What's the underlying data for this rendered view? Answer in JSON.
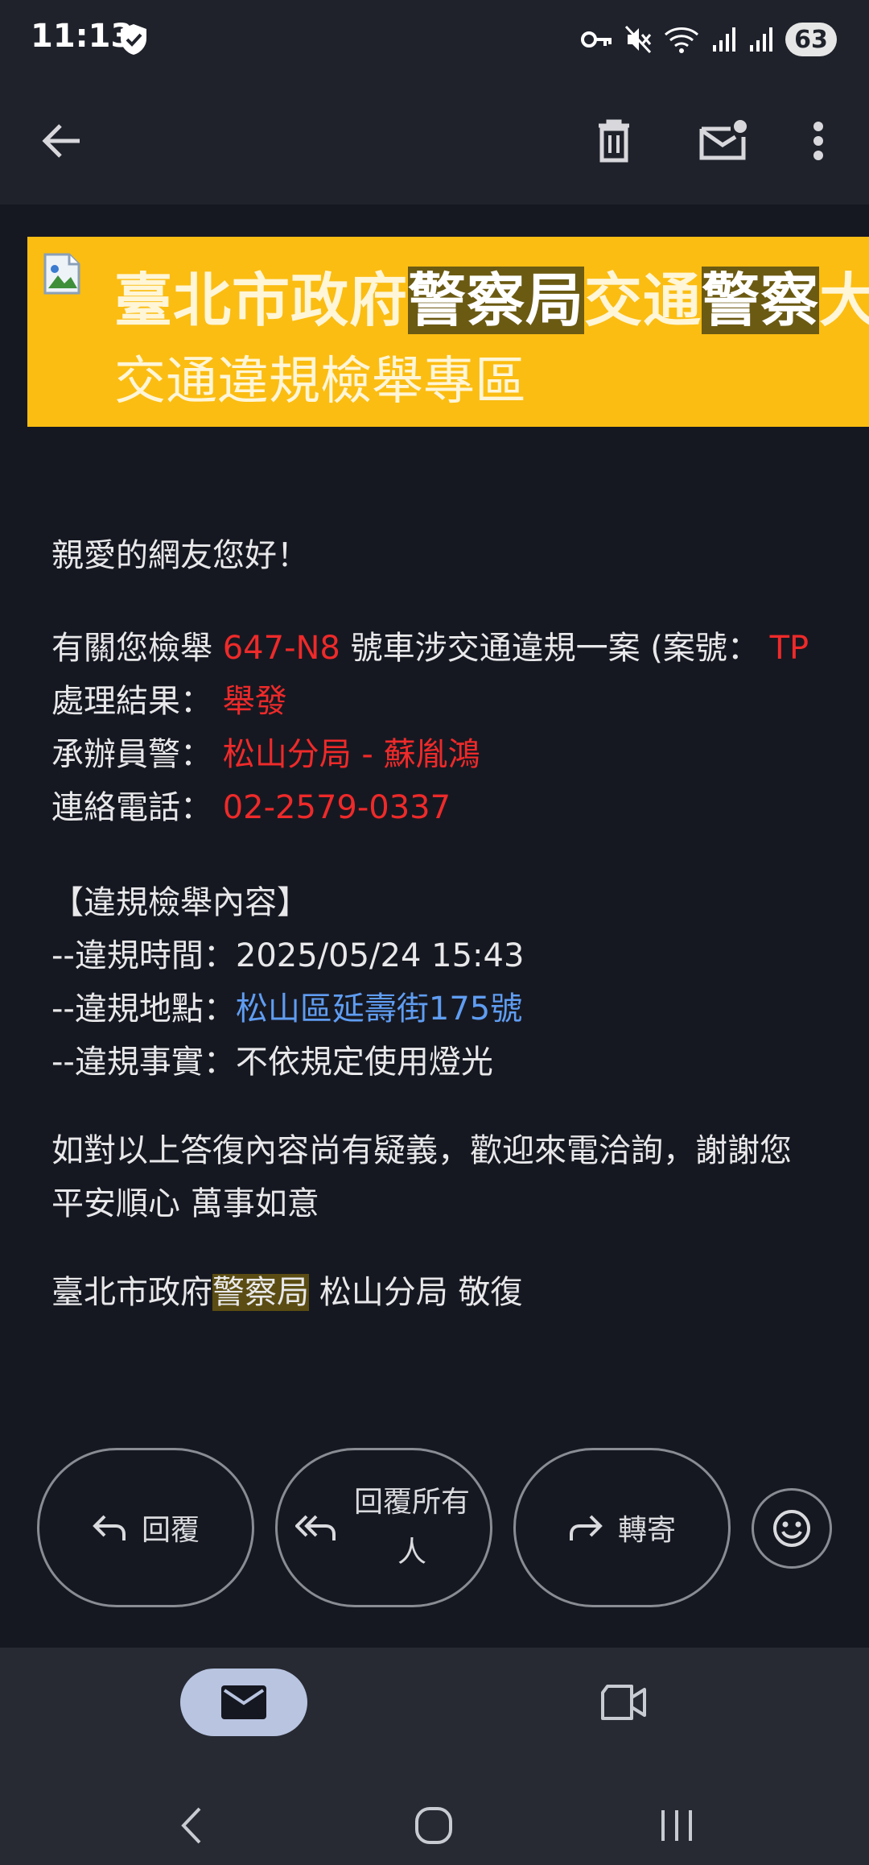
{
  "status_bar": {
    "time": "11:13",
    "battery": "63"
  },
  "app_bar": {
    "icons": [
      "arrow-back-icon",
      "trash-icon",
      "mark-unread-icon",
      "more-vert-icon"
    ]
  },
  "email": {
    "banner": {
      "line1_parts": [
        "臺北市政府",
        "警察局",
        "交通",
        "警察",
        "大"
      ],
      "line2": "交通違規檢舉專區"
    },
    "greeting": "親愛的網友您好！",
    "report_line": {
      "prefix": "有關您檢舉 ",
      "plate": "647-N8",
      "middle": " 號車涉交通違規一案 (案號： ",
      "case_no": "TP"
    },
    "result": {
      "label": "處理結果： ",
      "value": "舉發"
    },
    "officer": {
      "label": "承辦員警： ",
      "value": "松山分局 - 蘇胤鴻"
    },
    "phone": {
      "label": "連絡電話： ",
      "value": "02-2579-0337"
    },
    "section_title": "【違規檢舉內容】",
    "violation_time": "--違規時間：2025/05/24 15:43",
    "violation_place": {
      "label": "--違規地點：",
      "value": "松山區延壽街175號"
    },
    "violation_fact": "--違規事實：不依規定使用燈光",
    "closing_line1": "如對以上答復內容尚有疑義，歡迎來電洽詢，謝謝您",
    "closing_line2": "平安順心 萬事如意",
    "signature": {
      "part1": "臺北市政府",
      "part2": "警察局",
      "part3": " 松山分局 敬復"
    }
  },
  "actions": {
    "reply": "回覆",
    "reply_all_line1": "回覆所有",
    "reply_all_line2": "人",
    "forward": "轉寄"
  },
  "colors": {
    "banner": "#fbbd12",
    "accent_red": "#ee2a2a",
    "link_blue": "#5f9df2",
    "mail_tab": "#b8c4e0"
  }
}
